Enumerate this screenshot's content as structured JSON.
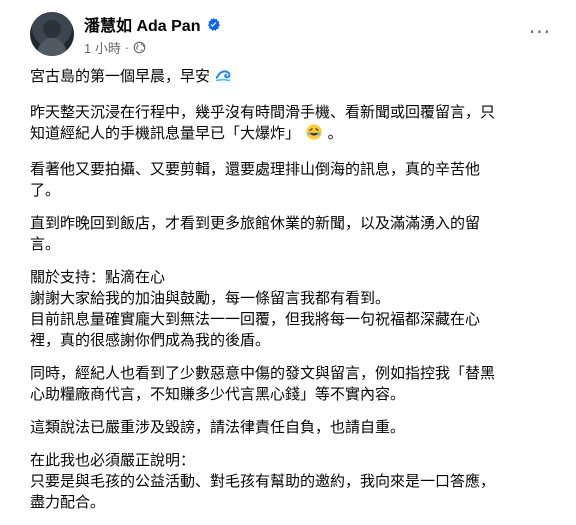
{
  "post_header": {
    "author_name": "潘慧如 Ada Pan",
    "timestamp": "1 小時",
    "separator": "·",
    "verified_icon": "verified-badge-icon",
    "privacy_icon": "globe-icon",
    "more_icon": "more-options-icon",
    "more_label": "···"
  },
  "post_body": {
    "p1": "宮古島的第一個早晨，早安",
    "p2a": "昨天整天沉浸在行程中，幾乎沒有時間滑手機、看新聞或回覆留言，只",
    "p2b": "知道經紀人的手機訊息量早已「大爆炸」",
    "p3a": "看著他又要拍攝、又要剪輯，還要處理排山倒海的訊息，真的辛苦他",
    "p3b": "了。",
    "p4a": "直到昨晚回到飯店，才看到更多旅館休業的新聞，以及滿滿湧入的留",
    "p4b": "言。",
    "p5a": "關於支持：點滴在心",
    "p5b": "謝謝大家給我的加油與鼓勵，每一條留言我都有看到。",
    "p5c": "目前訊息量確實龐大到無法一一回覆，但我將每一句祝福都深藏在心",
    "p5d": "裡，真的很感謝你們成為我的後盾。",
    "p6a": "同時，經紀人也看到了少數惡意中傷的發文與留言，例如指控我「替黑",
    "p6b": "心助糧廠商代言，不知賺多少代言黑心錢」等不實內容。",
    "p7": "這類說法已嚴重涉及毀謗，請法律責任自負，也請自重。",
    "p8a": "在此我也必須嚴正說明：",
    "p8b": "只要是與毛孩的公益活動、對毛孩有幫助的邀約，我向來是一口答應，",
    "p8c": "盡力配合。"
  },
  "icons": {
    "wave": "wave-emoji-icon",
    "laugh": "laughing-emoji-icon"
  },
  "colors": {
    "verified_blue": "#0866ff",
    "meta_gray": "#65676b",
    "text": "#050505"
  }
}
